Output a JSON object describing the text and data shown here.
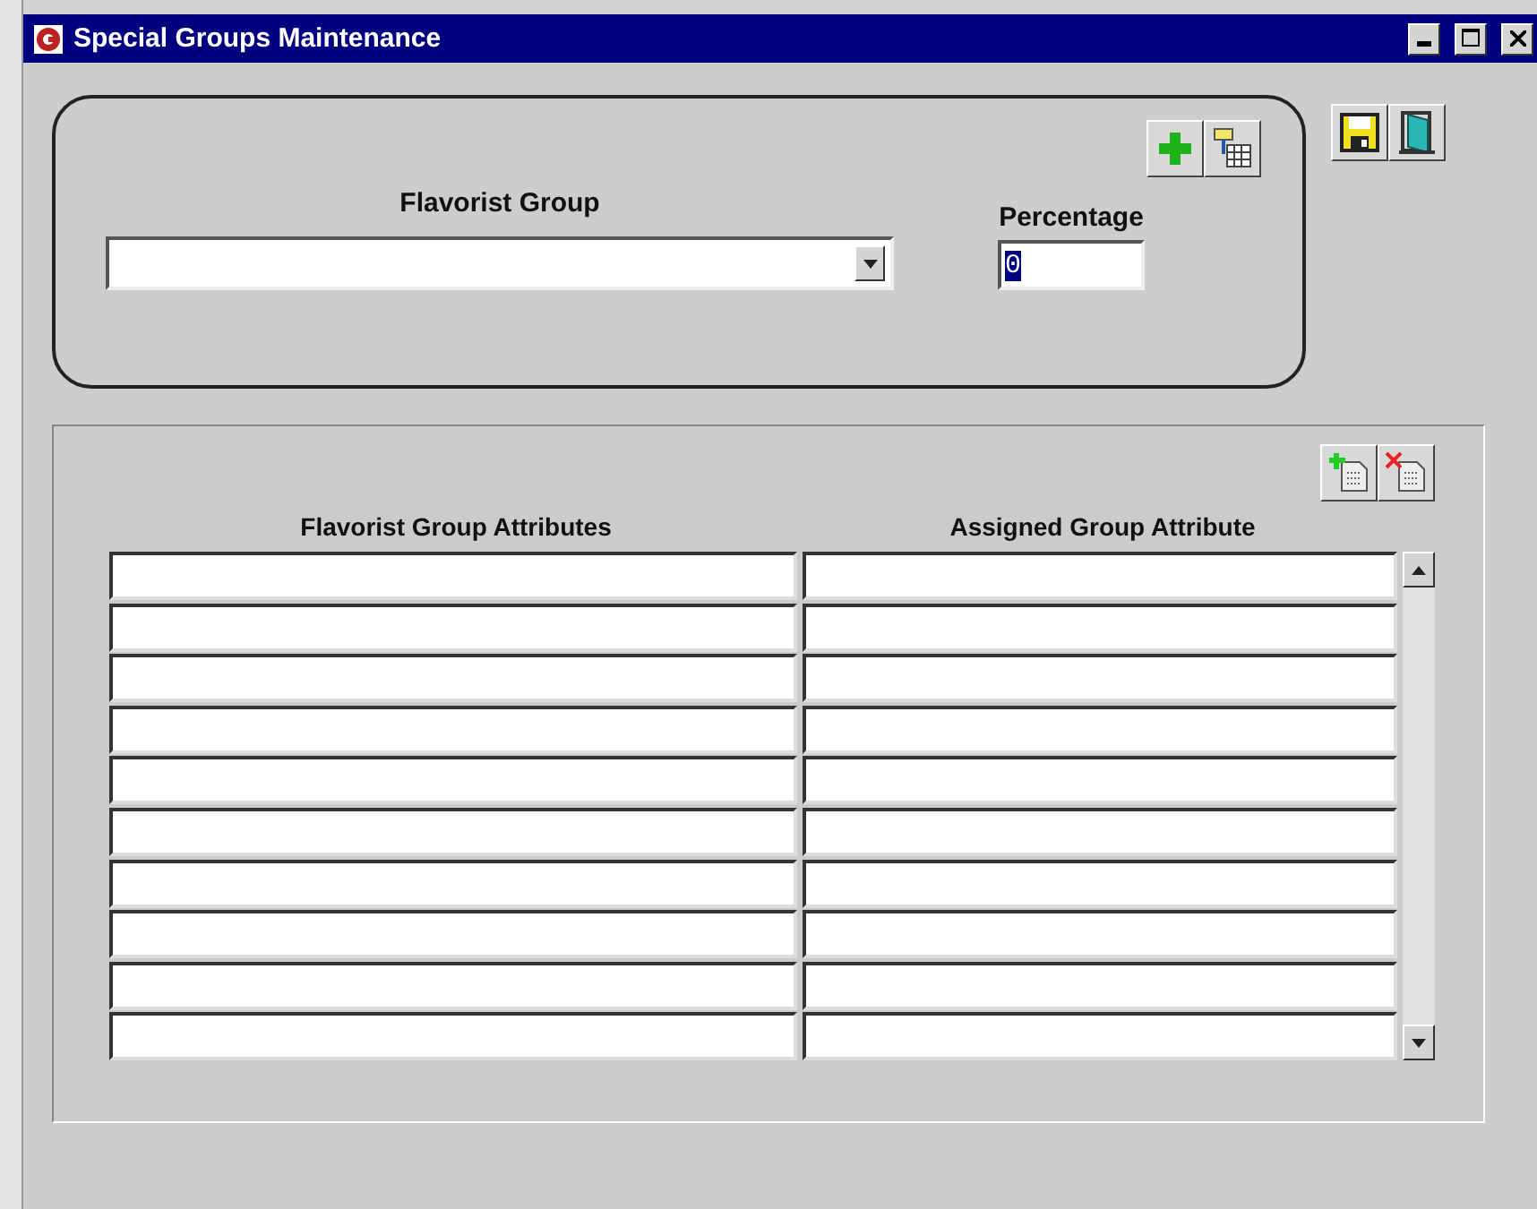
{
  "window": {
    "title": "Special Groups Maintenance"
  },
  "header": {
    "flavorist_group": {
      "label": "Flavorist Group"
    },
    "percentage": {
      "label": "Percentage",
      "value": "0",
      "text_selected": true
    }
  },
  "attributes": {
    "columns": [
      "Flavorist Group Attributes",
      "Assigned Group Attribute"
    ],
    "rows": [
      {
        "kind": "blank"
      },
      {
        "kind": "blank"
      },
      {
        "kind": "blank"
      },
      {
        "kind": "blank"
      },
      {
        "kind": "blank"
      },
      {
        "kind": "blank"
      },
      {
        "kind": "blank"
      },
      {
        "kind": "blank"
      },
      {
        "kind": "blank"
      },
      {
        "kind": "blank"
      }
    ]
  }
}
